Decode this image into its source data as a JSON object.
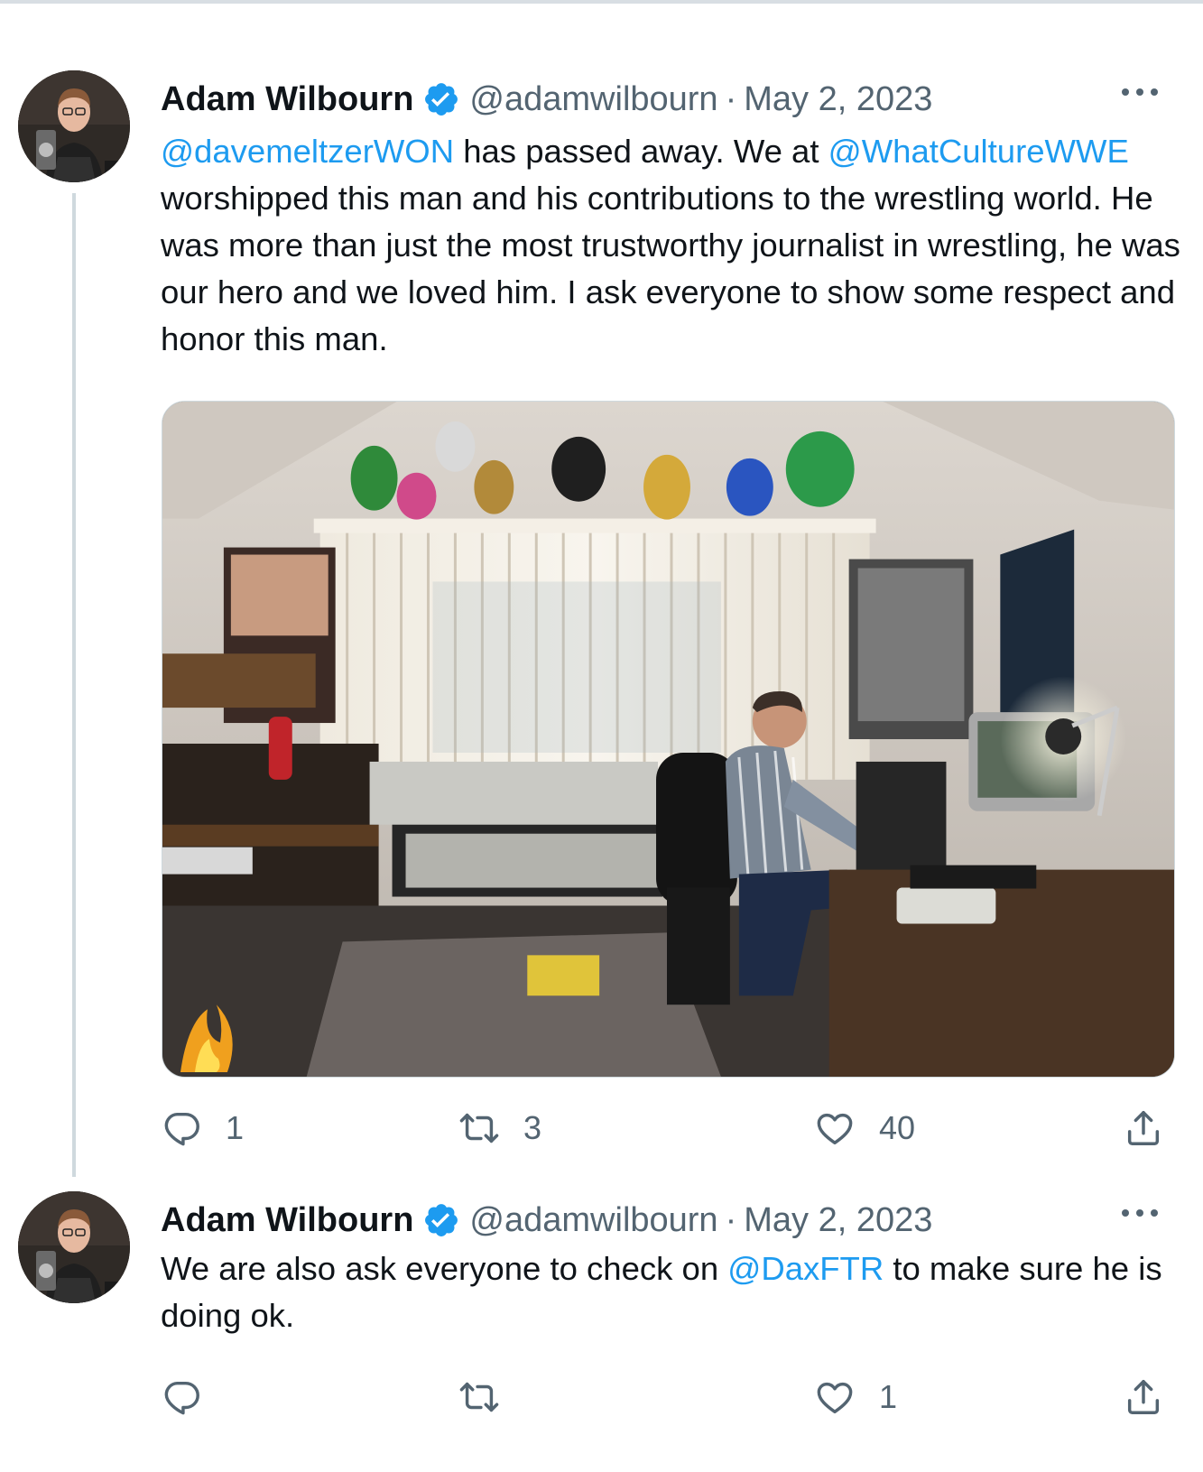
{
  "tweets": [
    {
      "author": {
        "name": "Adam Wilbourn",
        "handle": "@adamwilbourn",
        "separator": "·",
        "date": "May 2, 2023",
        "verified_icon": "verified-badge-icon",
        "avatar_icon": "avatar"
      },
      "text": {
        "segments": [
          {
            "type": "mention",
            "text": "@davemeltzerWON"
          },
          {
            "type": "text",
            "text": " has passed away. We at "
          },
          {
            "type": "mention",
            "text": "@WhatCultureWWE"
          },
          {
            "type": "text",
            "text": " worshipped this man and his contributions to the wrestling world. He was more than just the most trustworthy journalist in wrestling, he was our hero and we loved him. I ask everyone to show some respect and honor this man."
          }
        ]
      },
      "media": {
        "type": "photo"
      },
      "actions": {
        "reply_count": "1",
        "retweet_count": "3",
        "like_count": "40",
        "icons": [
          "reply-icon",
          "retweet-icon",
          "like-icon",
          "share-icon"
        ]
      }
    },
    {
      "author": {
        "name": "Adam Wilbourn",
        "handle": "@adamwilbourn",
        "separator": "·",
        "date": "May 2, 2023",
        "verified_icon": "verified-badge-icon",
        "avatar_icon": "avatar"
      },
      "text": {
        "segments": [
          {
            "type": "text",
            "text": "We are also ask everyone to check on "
          },
          {
            "type": "mention",
            "text": "@DaxFTR"
          },
          {
            "type": "text",
            "text": " to make sure he is doing ok."
          }
        ]
      },
      "actions": {
        "reply_count": "",
        "retweet_count": "",
        "like_count": "1",
        "icons": [
          "reply-icon",
          "retweet-icon",
          "like-icon",
          "share-icon"
        ]
      }
    }
  ],
  "colors": {
    "link": "#1d9bf0",
    "text": "#0f1419",
    "secondary": "#536471",
    "thread_line": "#cfd9de"
  }
}
